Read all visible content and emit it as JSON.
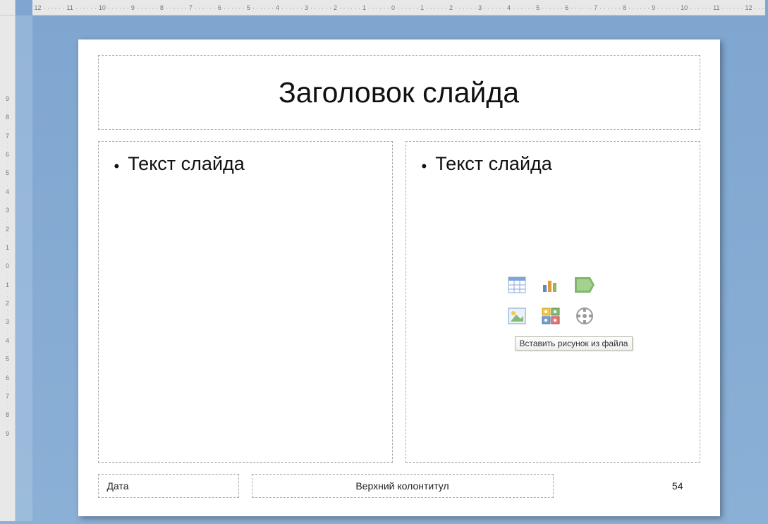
{
  "ruler": {
    "horizontal": [
      "12",
      "11",
      "10",
      "9",
      "8",
      "7",
      "6",
      "5",
      "4",
      "3",
      "2",
      "1",
      "0",
      "1",
      "2",
      "3",
      "4",
      "5",
      "6",
      "7",
      "8",
      "9",
      "10",
      "11",
      "12"
    ],
    "vertical": [
      "9",
      "8",
      "7",
      "6",
      "5",
      "4",
      "3",
      "2",
      "1",
      "0",
      "1",
      "2",
      "3",
      "4",
      "5",
      "6",
      "7",
      "8",
      "9"
    ]
  },
  "title": "Заголовок слайда",
  "left_col": {
    "bullet": "Текст слайда"
  },
  "right_col": {
    "bullet": "Текст слайда",
    "icons": {
      "table": "table-icon",
      "chart": "chart-icon",
      "smartart": "smartart-icon",
      "picture": "picture-icon",
      "clipart": "clipart-icon",
      "media": "media-icon"
    },
    "tooltip": "Вставить рисунок из файла"
  },
  "footer": {
    "date": "Дата",
    "header": "Верхний колонтитул",
    "number": "54"
  }
}
